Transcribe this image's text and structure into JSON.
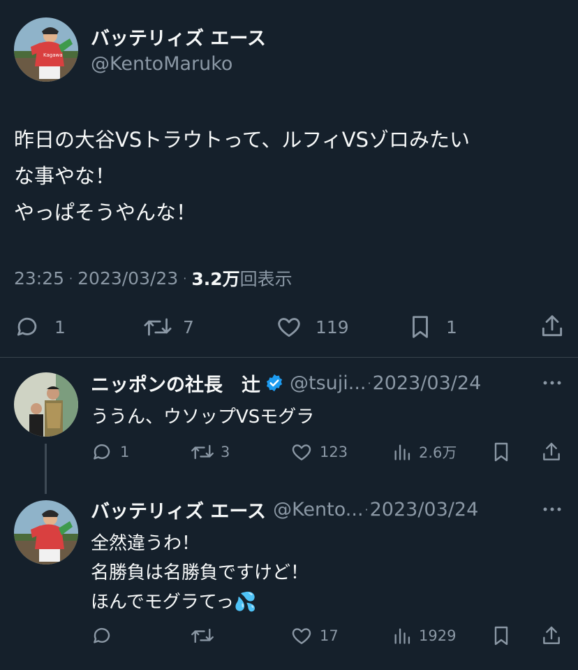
{
  "colors": {
    "background": "#15202b",
    "text": "#f7f9f9",
    "muted": "#8b98a5",
    "verified": "#1d9bf0",
    "divider": "#38444d"
  },
  "main_tweet": {
    "author_name": "バッテリィズ エース",
    "author_handle": "@KentoMaruko",
    "text_lines": [
      "昨日の大谷VSトラウトって、ルフィVSゾロみたい",
      "な事やな！",
      "やっぱそうやんな！"
    ],
    "time": "23:25",
    "date": "2023/03/23",
    "separator": "·",
    "views_count": "3.2万",
    "views_label": "回表示",
    "actions": {
      "replies": "1",
      "retweets": "7",
      "likes": "119",
      "bookmarks": "1"
    }
  },
  "replies": [
    {
      "author_name": "ニッポンの社長　辻",
      "author_handle": "@tsuji...",
      "separator": "·",
      "date": "2023/03/24",
      "verified": true,
      "text_lines": [
        "ううん、ウソップVSモグラ"
      ],
      "actions": {
        "replies": "1",
        "retweets": "3",
        "likes": "123",
        "views": "2.6万"
      }
    },
    {
      "author_name": "バッテリィズ エース",
      "author_handle": "@Kento...",
      "separator": "·",
      "date": "2023/03/24",
      "verified": false,
      "text_lines": [
        "全然違うわ！",
        "名勝負は名勝負ですけど！",
        "ほんでモグラてっ💦"
      ],
      "actions": {
        "replies": "",
        "retweets": "",
        "likes": "17",
        "views": "1929"
      }
    }
  ],
  "icons": {
    "reply": "speech-bubble-icon",
    "retweet": "retweet-arrows-icon",
    "like": "heart-icon",
    "bookmark": "bookmark-icon",
    "share": "share-upload-icon",
    "views": "bar-chart-icon",
    "more": "more-dots-icon",
    "verified": "verified-badge-icon"
  }
}
